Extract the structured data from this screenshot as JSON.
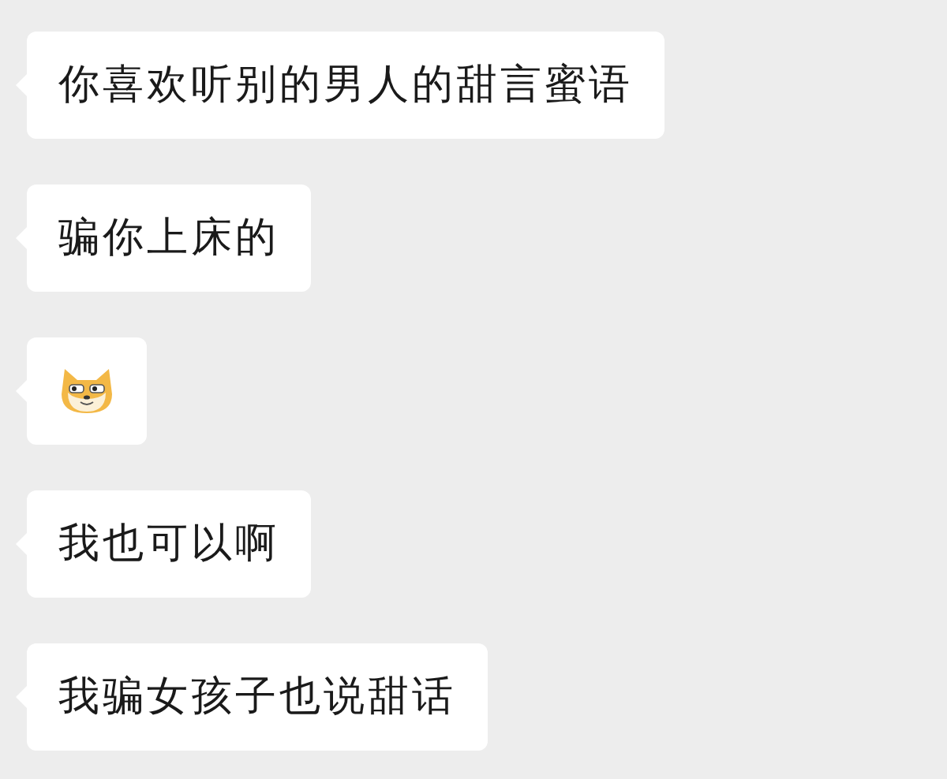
{
  "messages": [
    {
      "kind": "text",
      "text": "你喜欢听别的男人的甜言蜜语"
    },
    {
      "kind": "text",
      "text": "骗你上床的"
    },
    {
      "kind": "sticker"
    },
    {
      "kind": "text",
      "text": "我也可以啊"
    },
    {
      "kind": "text",
      "text": "我骗女孩子也说甜话"
    }
  ]
}
